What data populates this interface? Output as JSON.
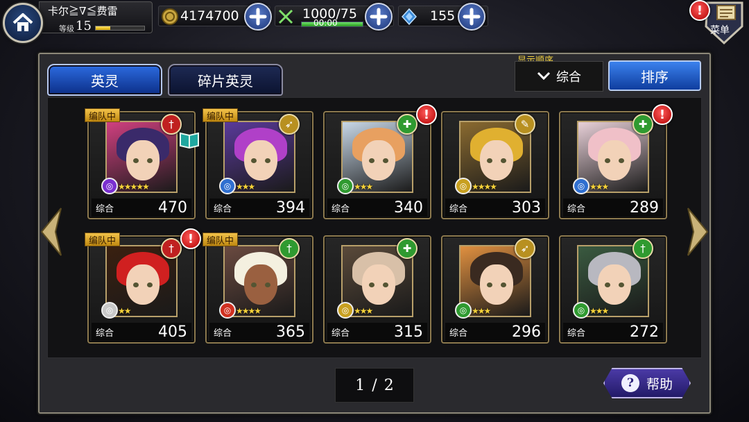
{
  "player": {
    "name": "卡尔≧∇≦费雷",
    "level_label": "等级",
    "level": "15",
    "exp_fraction": 0.3
  },
  "resources": {
    "gold": "4174700",
    "stamina": "1000/75",
    "stamina_timer": "00:00",
    "gems": "155"
  },
  "menu": {
    "label": "菜单"
  },
  "tabs": [
    {
      "label": "英灵",
      "active": true
    },
    {
      "label": "碎片英灵",
      "active": false
    }
  ],
  "sort": {
    "heading": "显示顺序",
    "selected": "综合",
    "button_label": "排序"
  },
  "stat_label": "综合",
  "party_tag": "编队中",
  "heroes": [
    {
      "value": "470",
      "stars": "★★★★★",
      "element_color": "#7a2fd0",
      "role": "sword-red",
      "in_party": true,
      "alert": false,
      "book": true
    },
    {
      "value": "394",
      "stars": "★★★",
      "element_color": "#2f6fd0",
      "role": "bow",
      "in_party": true,
      "alert": false,
      "book": false
    },
    {
      "value": "340",
      "stars": "★★★",
      "element_color": "#2f9a30",
      "role": "heal",
      "in_party": false,
      "alert": true,
      "book": false
    },
    {
      "value": "303",
      "stars": "★★★★",
      "element_color": "#c8a020",
      "role": "wand",
      "in_party": false,
      "alert": false,
      "book": false
    },
    {
      "value": "289",
      "stars": "★★★",
      "element_color": "#2f6fd0",
      "role": "heal",
      "in_party": false,
      "alert": true,
      "book": false
    },
    {
      "value": "405",
      "stars": "★★",
      "element_color": "#c8c8c8",
      "role": "sword-red",
      "in_party": true,
      "alert": true,
      "book": false
    },
    {
      "value": "365",
      "stars": "★★★★",
      "element_color": "#d03020",
      "role": "sword",
      "in_party": true,
      "alert": false,
      "book": false
    },
    {
      "value": "315",
      "stars": "★★★",
      "element_color": "#c8a020",
      "role": "heal",
      "in_party": false,
      "alert": false,
      "book": false
    },
    {
      "value": "296",
      "stars": "★★★",
      "element_color": "#2f9a30",
      "role": "bow",
      "in_party": false,
      "alert": false,
      "book": false
    },
    {
      "value": "272",
      "stars": "★★★",
      "element_color": "#2f9a30",
      "role": "sword",
      "in_party": false,
      "alert": false,
      "book": false
    }
  ],
  "pagination": {
    "current": "1",
    "separator": "/",
    "total": "2"
  },
  "help": {
    "label": "帮助"
  }
}
